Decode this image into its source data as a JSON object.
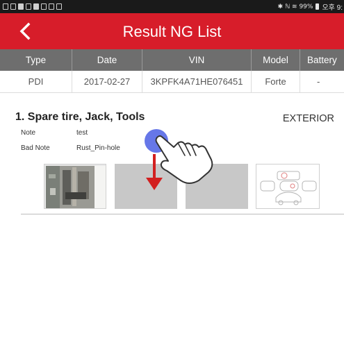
{
  "statusbar": {
    "right_text": "✱ ℕ ≋ 99%",
    "clock": "오후 9:"
  },
  "header": {
    "title": "Result NG List",
    "background_color": "#d71d2a"
  },
  "table": {
    "columns": [
      "Type",
      "Date",
      "VIN",
      "Model",
      "Battery"
    ],
    "row": [
      "PDI",
      "2017-02-27",
      "3KPFK4A71HE076451",
      "Forte",
      "-"
    ]
  },
  "item": {
    "title": "1. Spare tire, Jack, Tools",
    "category": "EXTERIOR",
    "note_label": "Note",
    "note_value": "test",
    "bad_note_label": "Bad Note",
    "bad_note_value": "Rust_Pin-hole",
    "photos": [
      {
        "type": "photo"
      },
      {
        "type": "placeholder"
      },
      {
        "type": "placeholder"
      },
      {
        "type": "car-diagram"
      }
    ]
  },
  "gesture": {
    "type": "drag-down",
    "dot_color": "#6677e8",
    "arrow_color": "#d21f1f"
  }
}
